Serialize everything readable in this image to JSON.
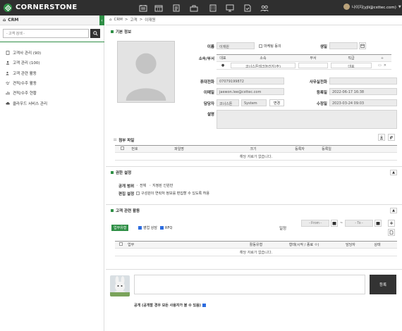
{
  "app": {
    "brand": "CORNERSTONE",
    "user_label": "나이지(yjli@csttec.com)"
  },
  "top_icons": [
    "ledger-icon",
    "calendar-icon",
    "list-icon",
    "bag-icon",
    "building-icon",
    "screen-icon",
    "document-check-icon",
    "people-icon"
  ],
  "sidebar": {
    "title": "CRM",
    "search_placeholder": "- 고객 검색 -",
    "items": [
      {
        "label": "고객사 관리 (90)",
        "icon": "building-icon"
      },
      {
        "label": "고객 관리 (100)",
        "icon": "person-icon"
      },
      {
        "label": "고객 관련 활동",
        "icon": "person-activity-icon"
      },
      {
        "label": "견적/수주 활동",
        "icon": "handshake-icon"
      },
      {
        "label": "견적/수주 현황",
        "icon": "chart-icon"
      },
      {
        "label": "클라우드 서비스 관리",
        "icon": "cloud-icon"
      }
    ]
  },
  "breadcrumb": {
    "root": "CRM",
    "level1": "고객",
    "level2": "이재원"
  },
  "basic_info": {
    "title": "기본 정보",
    "name_label": "이름",
    "name_value": "이재원",
    "marketing_label": "마케팅 동의",
    "birthday_label": "생일",
    "affiliation_label": "소속/부서",
    "aff_headers": [
      "대표",
      "소속",
      "부서",
      "직급"
    ],
    "aff_row": {
      "company": "코너스톤테크놀러지(주)",
      "rank": "대표"
    },
    "mobile_label": "휴대전화",
    "mobile_value": "07079199872",
    "office_label": "사무실전화",
    "email_label": "이메일",
    "email_value": "jaewon.lee@csttec.com",
    "reg_label": "등록일",
    "reg_value": "2022-06-17 16:38",
    "owner_label": "담당자",
    "owner_company": "코너스톤",
    "owner_name": "System",
    "owner_change": "변경",
    "mod_label": "수정일",
    "mod_value": "2023-03-24 09:03",
    "desc_label": "설명"
  },
  "attachments": {
    "title": "첨부 파일",
    "headers": [
      "번호",
      "파일명",
      "크기",
      "등록자",
      "등록일"
    ],
    "empty": "해당 자료가 없습니다."
  },
  "permission": {
    "title": "권한 설정",
    "scope_label": "공개 범위",
    "opt_all": "전체",
    "opt_selected": "지정된 인원만",
    "edit_label": "편집 설정",
    "edit_text": "구성원이 연락처 정보를 편집할 수 있도록 허용"
  },
  "activity": {
    "title": "고객 관련 활동",
    "task_type_btn": "업무유형",
    "opt_sales": "영업 상담",
    "opt_rfq": "RFQ",
    "period_label": "일정",
    "from_placeholder": "- From -",
    "to_placeholder": "- To -",
    "dash": "~",
    "headers": [
      "업무",
      "활동유형",
      "형태(시작 / 종료 ㅇ)",
      "담당자",
      "상태"
    ],
    "empty": "해당 자료가 없습니다."
  },
  "comment": {
    "submit": "등록",
    "public_label": "공개 (공개할 경우 모든 사용자가 볼 수 있음)"
  },
  "colors": {
    "accent": "#2f8f46",
    "topbar": "#2f2f2f",
    "dark_btn": "#333333"
  }
}
